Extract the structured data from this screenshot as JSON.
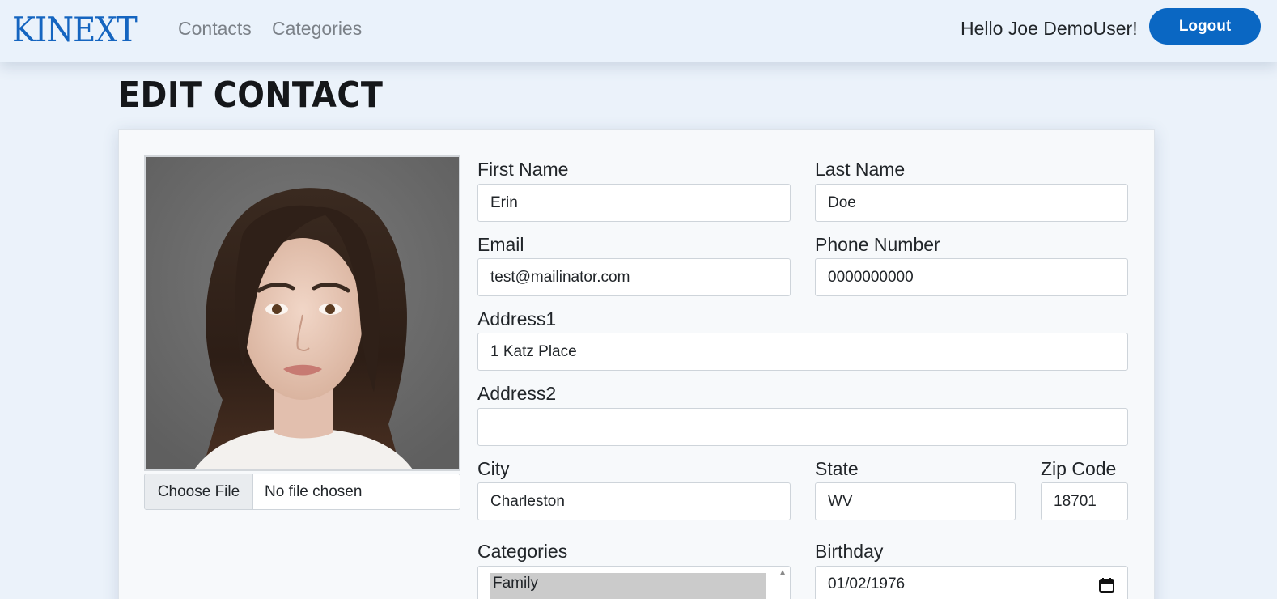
{
  "nav": {
    "brand": "KINEXT",
    "links": [
      "Contacts",
      "Categories"
    ],
    "greeting": "Hello Joe DemoUser!",
    "logout_label": "Logout"
  },
  "page": {
    "title": "EDIT CONTACT"
  },
  "photo": {
    "file_button": "Choose File",
    "file_status": "No file chosen"
  },
  "form": {
    "first_name": {
      "label": "First Name",
      "value": "Erin"
    },
    "last_name": {
      "label": "Last Name",
      "value": "Doe"
    },
    "email": {
      "label": "Email",
      "value": "test@mailinator.com"
    },
    "phone": {
      "label": "Phone Number",
      "value": "0000000000"
    },
    "address1": {
      "label": "Address1",
      "value": "1 Katz Place"
    },
    "address2": {
      "label": "Address2",
      "value": ""
    },
    "city": {
      "label": "City",
      "value": "Charleston"
    },
    "state": {
      "label": "State",
      "value": "WV"
    },
    "zip": {
      "label": "Zip Code",
      "value": "18701"
    },
    "categories": {
      "label": "Categories",
      "options": [
        "Family"
      ],
      "selected": "Family"
    },
    "birthday": {
      "label": "Birthday",
      "value": "01/02/1976"
    }
  },
  "colors": {
    "brand": "#1565c0",
    "primary_button": "#0a67c3",
    "page_bg": "#ebf2fa"
  }
}
